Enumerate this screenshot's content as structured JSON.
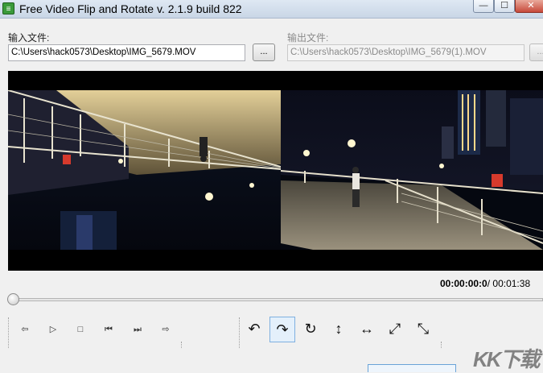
{
  "window": {
    "title": "Free Video Flip and Rotate  v. 2.1.9 build 822",
    "app_icon_glyph": "≡",
    "min_glyph": "—",
    "max_glyph": "☐",
    "close_glyph": "✕"
  },
  "input": {
    "label": "输入文件:",
    "value": "C:\\Users\\hack0573\\Desktop\\IMG_5679.MOV",
    "browse_label": "..."
  },
  "output": {
    "label": "输出文件:",
    "value": "C:\\Users\\hack0573\\Desktop\\IMG_5679(1).MOV",
    "browse_label": "..."
  },
  "playback": {
    "current_time": "00:00:00:0",
    "separator": "/",
    "total_time": "00:01:38",
    "position": 0,
    "controls": [
      {
        "name": "step-back-button",
        "glyph": "⇦"
      },
      {
        "name": "play-button",
        "glyph": "▷"
      },
      {
        "name": "stop-button",
        "glyph": "□"
      },
      {
        "name": "prev-frame-button",
        "glyph": "⏮"
      },
      {
        "name": "next-frame-button",
        "glyph": "⏭"
      },
      {
        "name": "step-forward-button",
        "glyph": "⇨"
      }
    ]
  },
  "transforms": [
    {
      "name": "rotate-left-button",
      "glyph": "↶"
    },
    {
      "name": "rotate-right-button",
      "glyph": "↷"
    },
    {
      "name": "rotate-180-button",
      "glyph": "↻"
    },
    {
      "name": "flip-vertical-button",
      "glyph": "↕"
    },
    {
      "name": "flip-horizontal-button",
      "glyph": "↔"
    },
    {
      "name": "diagonal-flip-button",
      "glyph": "⤢"
    },
    {
      "name": "anti-diagonal-flip-button",
      "glyph": "⤡"
    }
  ],
  "active_transform": 1,
  "bottom": {
    "faint_text": "",
    "watermark": "KK下载"
  },
  "colors": {
    "sky": "#0b0d1a",
    "ceiling_light": "#d8c28a",
    "water": "#0d1424",
    "rail": "#e7e2cf",
    "walkway": "#8a8270"
  }
}
